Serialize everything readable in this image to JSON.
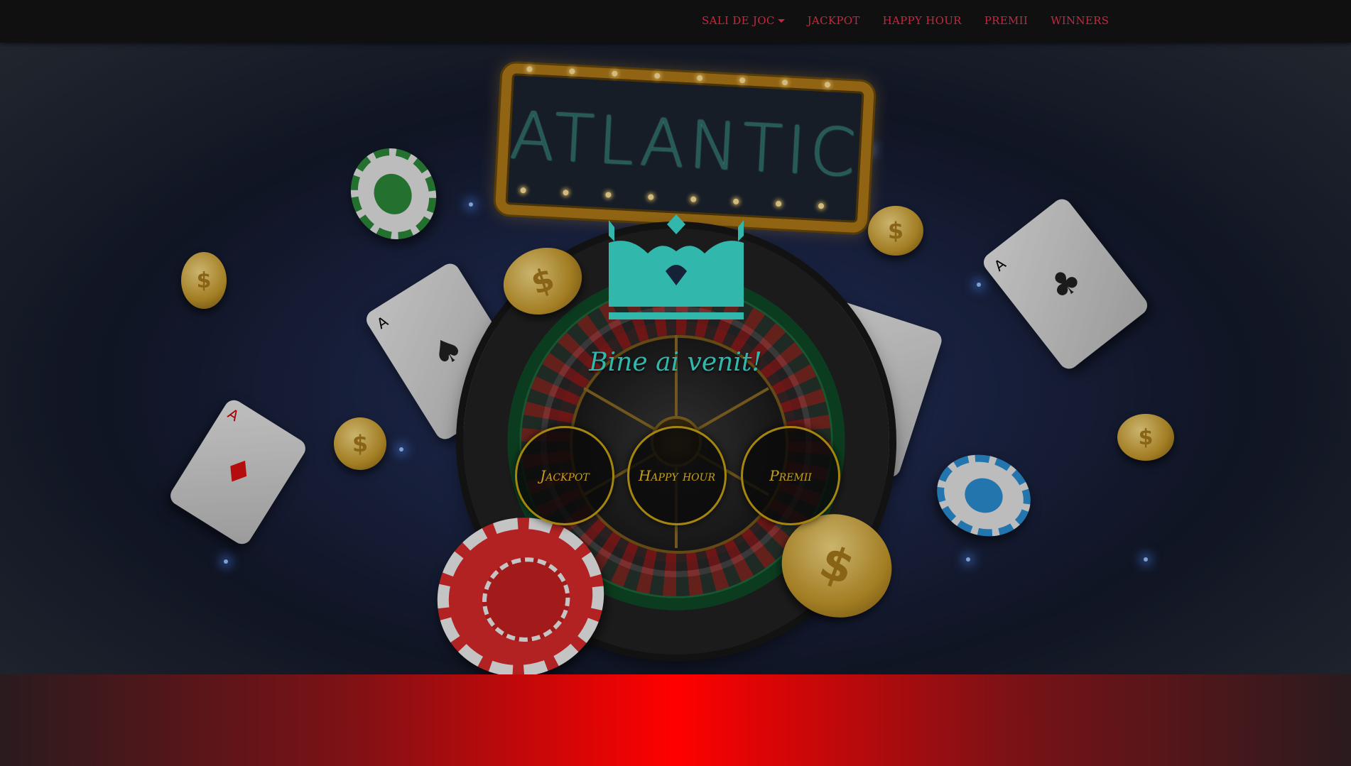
{
  "nav": {
    "items": [
      {
        "label": "SALI DE JOC",
        "dropdown": true
      },
      {
        "label": "JACKPOT"
      },
      {
        "label": "HAPPY HOUR"
      },
      {
        "label": "PREMII"
      },
      {
        "label": "WINNERS"
      }
    ]
  },
  "hero": {
    "logo_text": "ATLANTIC",
    "welcome": "Bine ai venit!",
    "buttons": [
      {
        "label": "Jackpot"
      },
      {
        "label": "Happy hour"
      },
      {
        "label": "Premii"
      }
    ]
  },
  "colors": {
    "nav_link": "#c4283f",
    "welcome": "#3ee0d2",
    "crown": "#3ee0d2",
    "button_border": "#c9a312",
    "button_text": "#f2c21c",
    "footer_red": "#ff0000"
  },
  "icons": [
    "caret-down-icon",
    "crown-icon"
  ]
}
